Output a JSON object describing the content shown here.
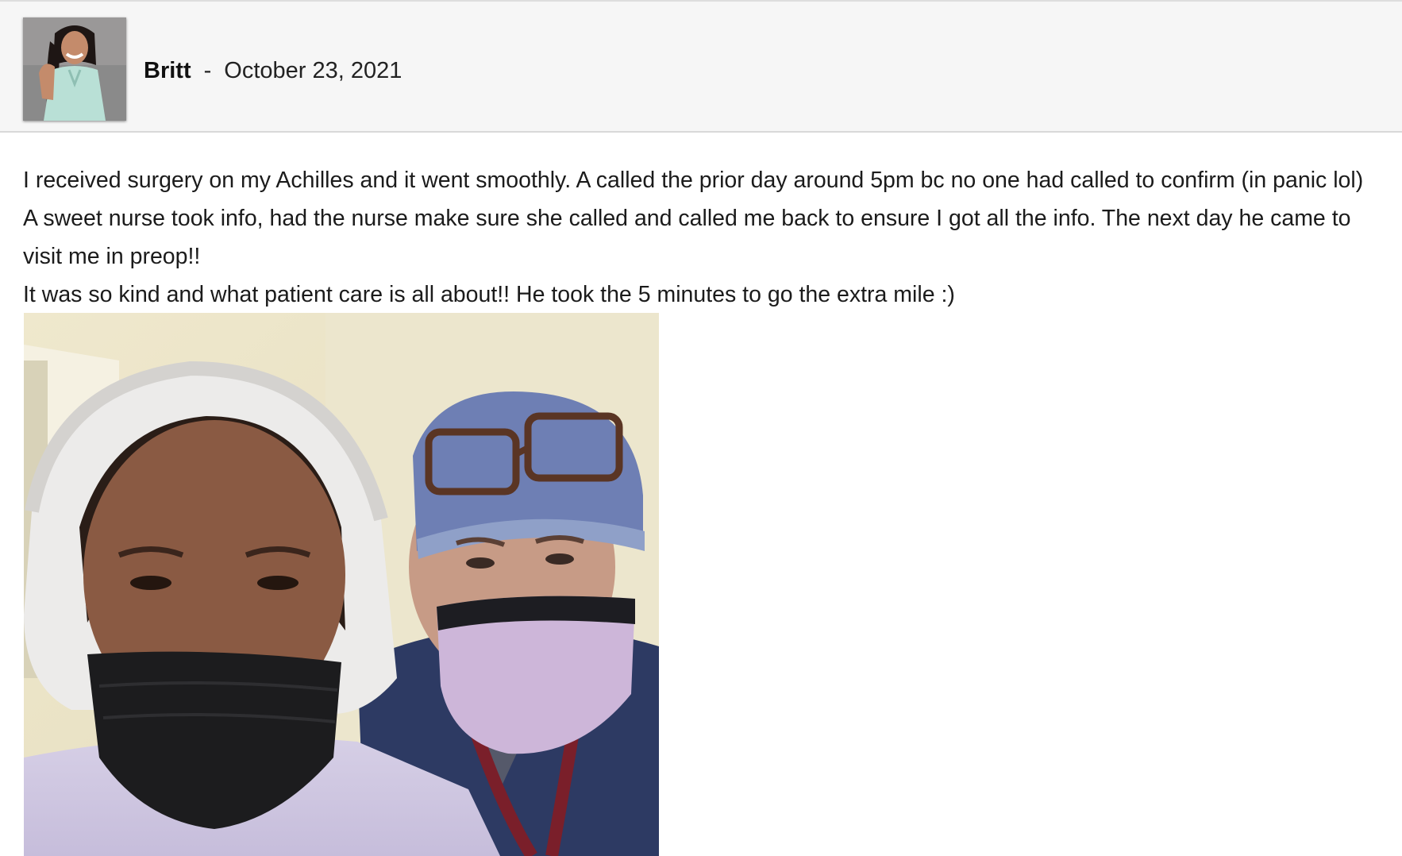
{
  "review": {
    "author": "Britt",
    "separator": "-",
    "date": "October 23, 2021",
    "body_lines": [
      "I received surgery on my Achilles and it went smoothly. A called the prior day around 5pm bc no one had called to confirm (in panic lol)",
      "A sweet nurse took info, had the nurse make sure she called and called me back to ensure I got all the info. The next day he came to",
      "visit me in preop!!",
      "It was so kind and what patient care is all about!! He took the 5 minutes to go the extra mile :)"
    ]
  },
  "icons": {
    "avatar": "user-avatar-photo",
    "attachment": "review-photo"
  },
  "colors": {
    "header_bg": "#f6f6f6",
    "text": "#1b1b1b"
  }
}
